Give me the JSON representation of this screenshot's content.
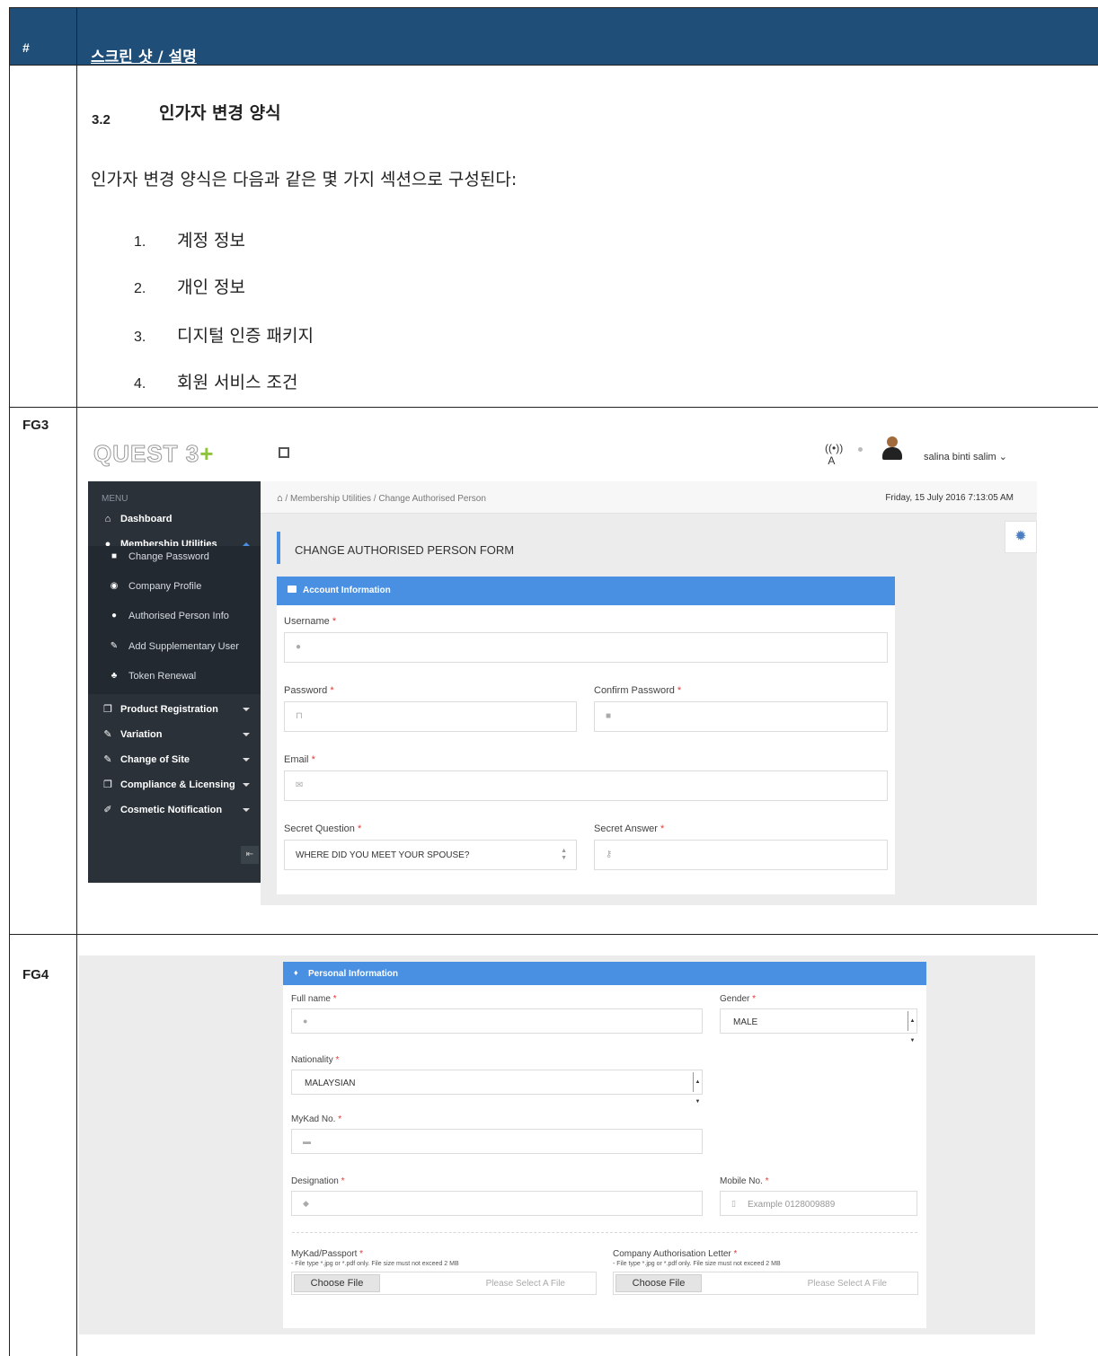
{
  "doc": {
    "hash": "#",
    "header_title": "스크린 샷 / 설명",
    "section_num": "3.2",
    "section_title": "인가자 변경 양식",
    "intro": "인가자 변경 양식은 다음과 같은 몇 가지 섹션으로 구성된다:",
    "list": [
      {
        "n": "1.",
        "t": "계정 정보"
      },
      {
        "n": "2.",
        "t": "개인 정보"
      },
      {
        "n": "3.",
        "t": "디지털 인증 패키지"
      },
      {
        "n": "4.",
        "t": "회원 서비스 조건"
      }
    ],
    "fg3": "FG3",
    "fg4": "FG4"
  },
  "fg3": {
    "logo": "QUEST 3",
    "logo_plus": "+",
    "user": "salina binti salim ⌄",
    "menu_label": "MENU",
    "sidebar": {
      "dashboard": "Dashboard",
      "membership": "Membership Utilities",
      "sub": [
        "Change Password",
        "Company Profile",
        "Authorised Person Info",
        "Add Supplementary User",
        "Token Renewal"
      ],
      "product": "Product Registration",
      "variation": "Variation",
      "change_site": "Change of Site",
      "compliance": "Compliance & Licensing",
      "cosmetic": "Cosmetic Notification"
    },
    "breadcrumb": [
      "Membership Utilities",
      "Change Authorised Person"
    ],
    "date": "Friday, 15 July 2016 7:13:05 AM",
    "form_title": "CHANGE AUTHORISED PERSON FORM",
    "panel_title": "Account Information",
    "fields": {
      "username": "Username",
      "password": "Password",
      "confirm_password": "Confirm Password",
      "email": "Email",
      "secret_question": "Secret Question",
      "secret_question_value": "WHERE DID YOU MEET YOUR SPOUSE?",
      "secret_answer": "Secret Answer"
    },
    "req": "*"
  },
  "fg4": {
    "panel_title": "Personal Information",
    "fields": {
      "full_name": "Full name",
      "gender": "Gender",
      "gender_value": "MALE",
      "nationality": "Nationality",
      "nationality_value": "MALAYSIAN",
      "mykad": "MyKad No.",
      "designation": "Designation",
      "mobile": "Mobile No.",
      "mobile_placeholder": "Example 0128009889",
      "mykad_passport": "MyKad/Passport",
      "company_letter": "Company Authorisation Letter",
      "file_hint": "- File type *.jpg or *.pdf only. File size must not exceed 2 MB",
      "choose_file": "Choose File",
      "file_placeholder": "Please Select A File"
    },
    "req": "*"
  }
}
